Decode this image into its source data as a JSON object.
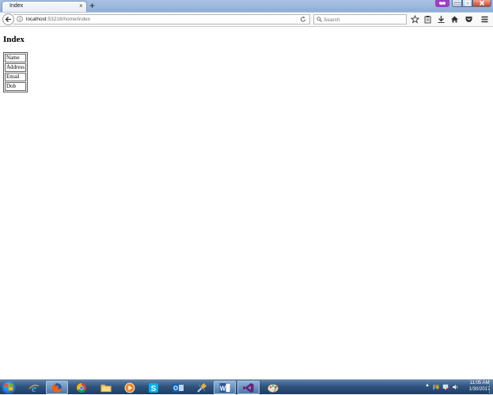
{
  "browser": {
    "tab": {
      "title": "Index",
      "close": "×"
    },
    "new_tab": "+",
    "url": {
      "host": "localhost",
      "path": ":53218/home/index"
    },
    "search": {
      "placeholder": "Search"
    }
  },
  "page": {
    "title": "Index",
    "table_rows": [
      "Name",
      "Address",
      "Email",
      "Dob"
    ]
  },
  "taskbar": {
    "tray_up": "▲",
    "time": "11:05 AM",
    "date": "1/30/2017"
  },
  "colors": {
    "accent_profile": "#9b3fc4",
    "close_button": "#c9452c",
    "taskbar": "#31547f"
  },
  "icons": [
    "info-icon",
    "reload-icon",
    "search-icon",
    "star-icon",
    "clipboard-icon",
    "download-icon",
    "home-icon",
    "pocket-icon",
    "menu-icon",
    "windows-logo-icon",
    "ie-icon",
    "firefox-icon",
    "chrome-icon",
    "folder-icon",
    "media-player-icon",
    "skype-icon",
    "outlook-icon",
    "tools-icon",
    "word-icon",
    "visual-studio-icon",
    "paint-icon"
  ]
}
